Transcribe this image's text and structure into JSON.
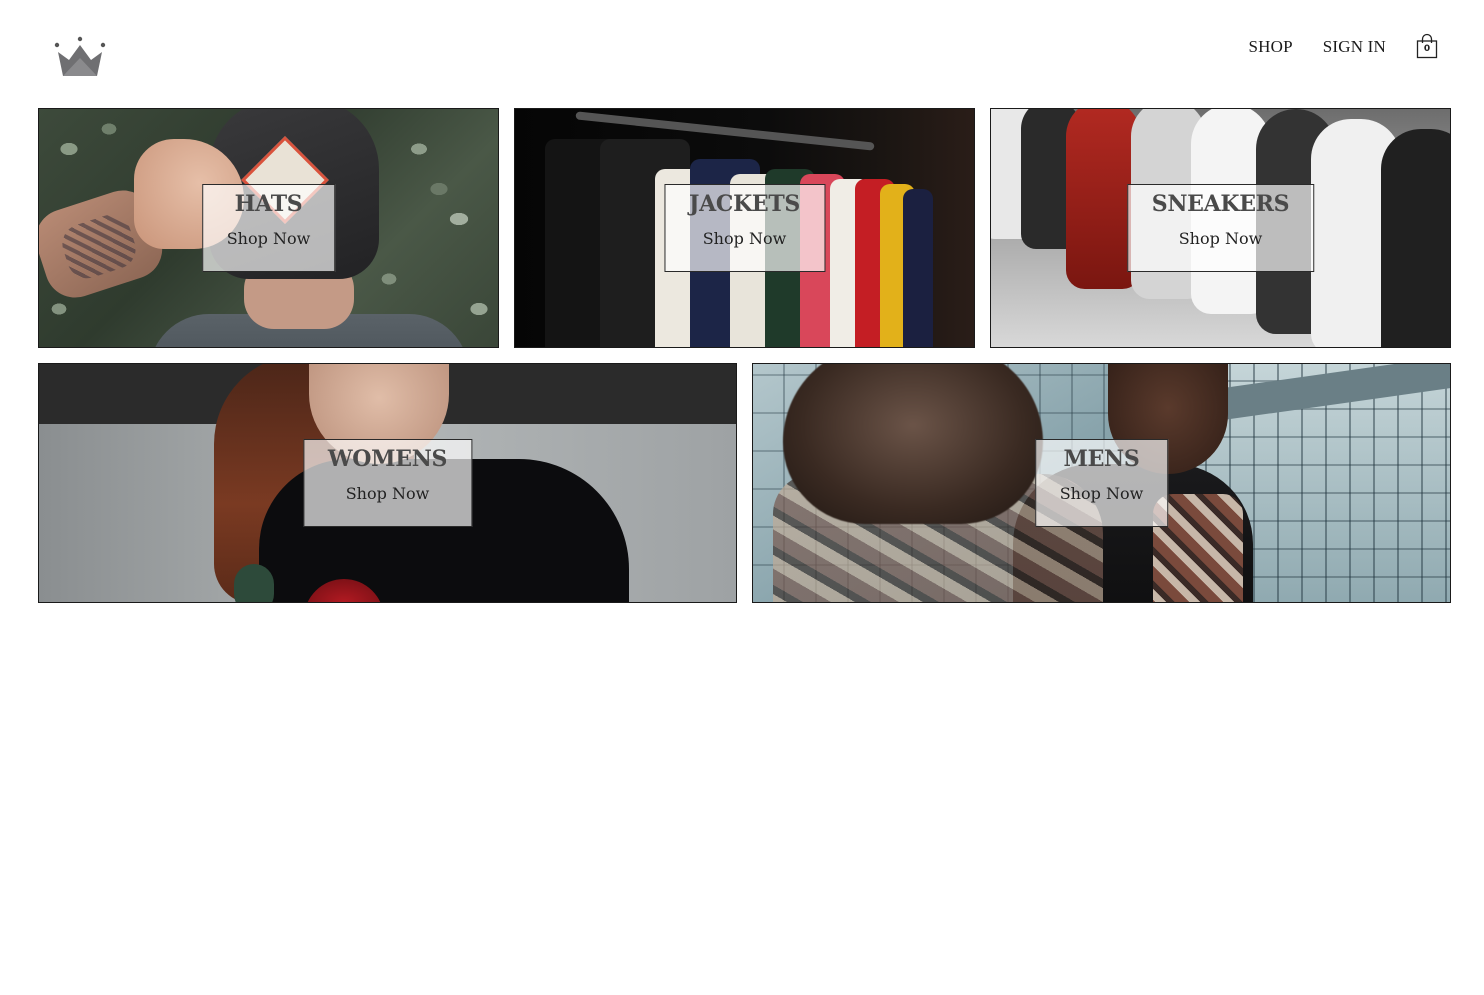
{
  "header": {
    "logo_icon": "crown-icon",
    "nav": [
      {
        "label": "SHOP"
      },
      {
        "label": "SIGN IN"
      }
    ],
    "cart": {
      "icon": "shopping-bag-icon",
      "count": "0"
    }
  },
  "directory": {
    "sections": [
      {
        "title": "HATS",
        "subtitle": "Shop Now"
      },
      {
        "title": "JACKETS",
        "subtitle": "Shop Now"
      },
      {
        "title": "SNEAKERS",
        "subtitle": "Shop Now"
      },
      {
        "title": "WOMENS",
        "subtitle": "Shop Now"
      },
      {
        "title": "MENS",
        "subtitle": "Shop Now"
      }
    ]
  },
  "colors": {
    "background": "#ffffff",
    "text": "#1a1a1a",
    "label_title": "#4a4a4a",
    "label_box": "rgba(255,255,255,0.68)",
    "logo": "#6f6f72"
  }
}
